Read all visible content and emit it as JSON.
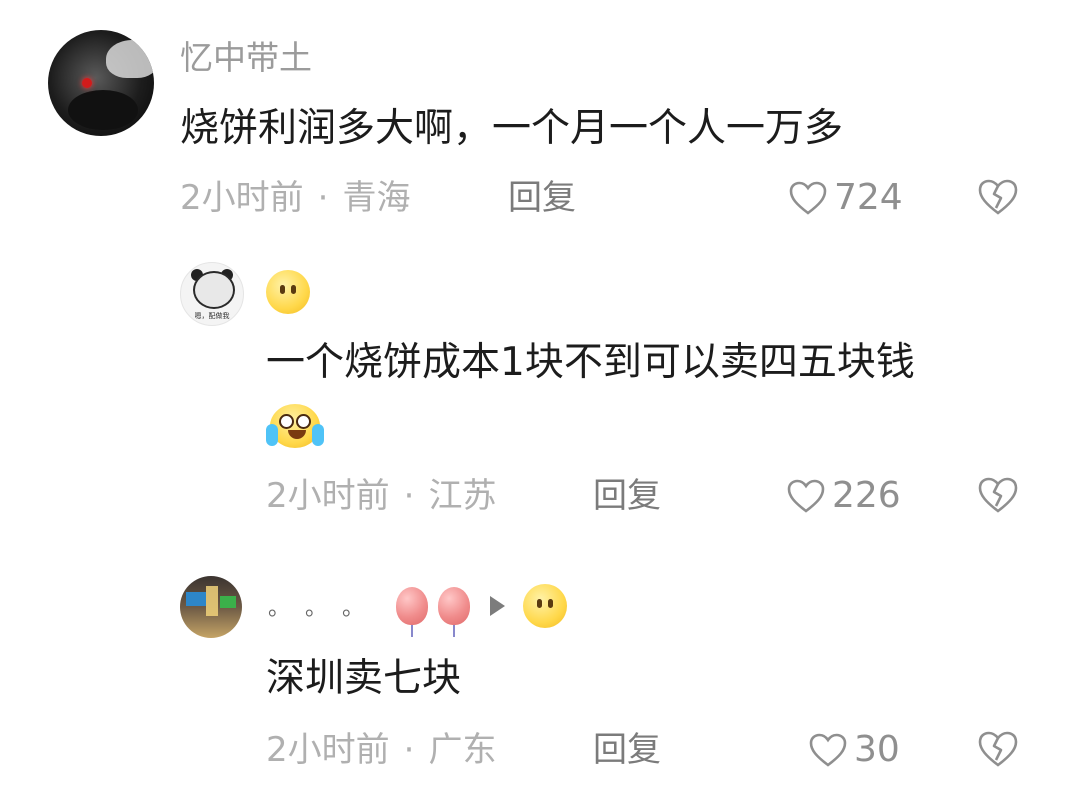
{
  "comments": [
    {
      "username": "忆中带土",
      "text": "烧饼利润多大啊，一个月一个人一万多",
      "time": "2小时前",
      "location": "青海",
      "reply_label": "回复",
      "likes": "724"
    },
    {
      "username_emoji": "neutral-face-emoji",
      "text": "一个烧饼成本1块不到可以卖四五块钱",
      "text_emoji": "crying-laughing-emoji",
      "avatar_caption": "嗯，配做我",
      "time": "2小时前",
      "location": "江苏",
      "reply_label": "回复",
      "likes": "226"
    },
    {
      "username_prefix": "。。。",
      "username_icons": [
        "balloon-icon",
        "balloon-icon",
        "play-icon",
        "neutral-face-emoji"
      ],
      "text": "深圳卖七块",
      "time": "2小时前",
      "location": "广东",
      "reply_label": "回复",
      "likes": "30"
    }
  ],
  "separator": "·",
  "colors": {
    "text_primary": "#1c1c1c",
    "text_secondary": "#9b9b9b",
    "icon_gray": "#8f8f8f"
  }
}
